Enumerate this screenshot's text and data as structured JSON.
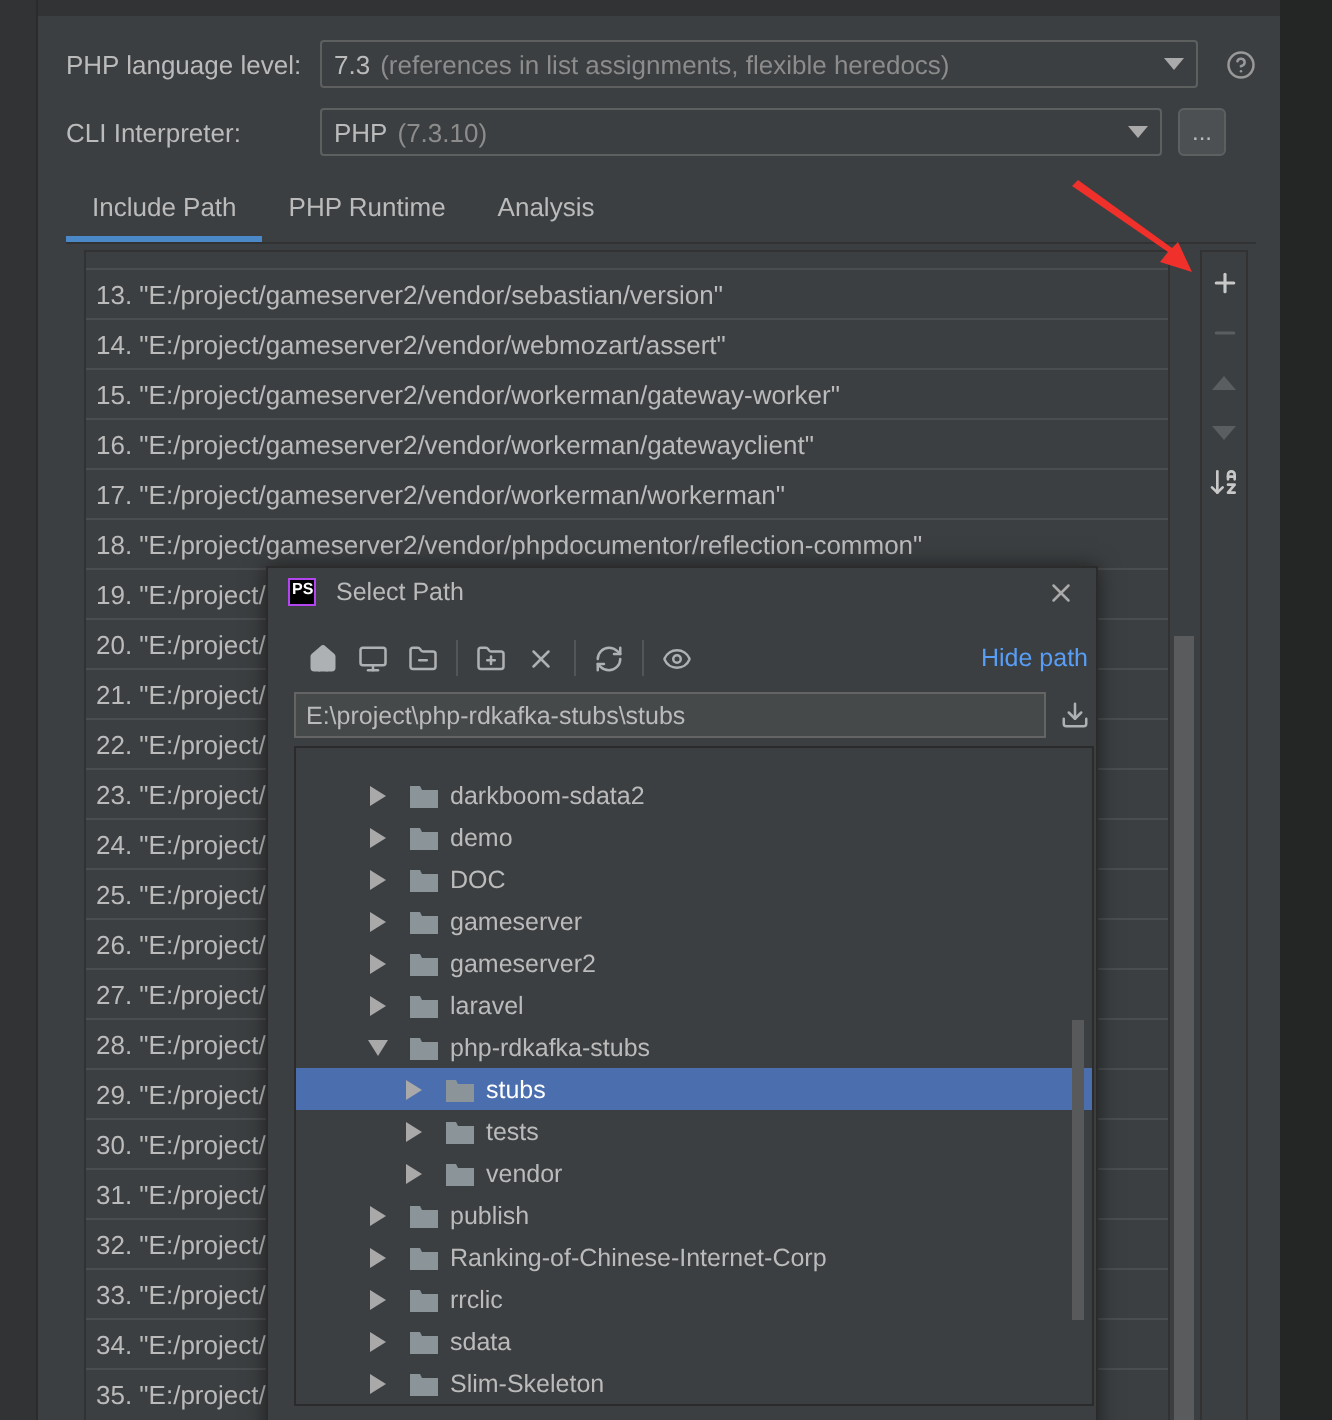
{
  "settings": {
    "language_level": {
      "label": "PHP language level:",
      "value": "7.3",
      "detail": "(references in list assignments, flexible heredocs)"
    },
    "interpreter": {
      "label": "CLI Interpreter:",
      "value": "PHP",
      "detail": "(7.3.10)",
      "button": "..."
    }
  },
  "tabs": [
    {
      "label": "Include Path",
      "selected": true
    },
    {
      "label": "PHP Runtime",
      "selected": false
    },
    {
      "label": "Analysis",
      "selected": false
    }
  ],
  "include_paths": [
    "13. \"E:/project/gameserver2/vendor/sebastian/version\"",
    "14. \"E:/project/gameserver2/vendor/webmozart/assert\"",
    "15. \"E:/project/gameserver2/vendor/workerman/gateway-worker\"",
    "16. \"E:/project/gameserver2/vendor/workerman/gatewayclient\"",
    "17. \"E:/project/gameserver2/vendor/workerman/workerman\"",
    "18. \"E:/project/gameserver2/vendor/phpdocumentor/reflection-common\"",
    "19. \"E:/project/",
    "20. \"E:/project/",
    "21. \"E:/project/",
    "22. \"E:/project/",
    "23. \"E:/project/",
    "24. \"E:/project/",
    "25. \"E:/project/",
    "26. \"E:/project/",
    "27. \"E:/project/",
    "28. \"E:/project/",
    "29. \"E:/project/",
    "30. \"E:/project/",
    "31. \"E:/project/",
    "32. \"E:/project/",
    "33. \"E:/project/",
    "34. \"E:/project/",
    "35. \"E:/project/"
  ],
  "toolbar": [
    {
      "kind": "add",
      "disabled": false
    },
    {
      "kind": "remove",
      "disabled": true
    },
    {
      "kind": "up",
      "disabled": true
    },
    {
      "kind": "down",
      "disabled": true
    },
    {
      "kind": "sort",
      "disabled": false
    }
  ],
  "dialog": {
    "title": "Select Path",
    "logo": "PS",
    "hide_path": "Hide path",
    "path": "E:\\project\\php-rdkafka-stubs\\stubs",
    "tree": [
      {
        "name": "darkboom-sdata2",
        "expanded": false,
        "selected": false
      },
      {
        "name": "demo",
        "expanded": false,
        "selected": false
      },
      {
        "name": "DOC",
        "expanded": false,
        "selected": false
      },
      {
        "name": "gameserver",
        "expanded": false,
        "selected": false
      },
      {
        "name": "gameserver2",
        "expanded": false,
        "selected": false
      },
      {
        "name": "laravel",
        "expanded": false,
        "selected": false
      },
      {
        "name": "php-rdkafka-stubs",
        "expanded": true,
        "selected": false,
        "children": [
          {
            "name": "stubs",
            "expanded": false,
            "selected": true
          },
          {
            "name": "tests",
            "expanded": false,
            "selected": false
          },
          {
            "name": "vendor",
            "expanded": false,
            "selected": false
          }
        ]
      },
      {
        "name": "publish",
        "expanded": false,
        "selected": false
      },
      {
        "name": "Ranking-of-Chinese-Internet-Corp",
        "expanded": false,
        "selected": false
      },
      {
        "name": "rrclic",
        "expanded": false,
        "selected": false
      },
      {
        "name": "sdata",
        "expanded": false,
        "selected": false
      },
      {
        "name": "Slim-Skeleton",
        "expanded": false,
        "selected": false
      }
    ]
  }
}
